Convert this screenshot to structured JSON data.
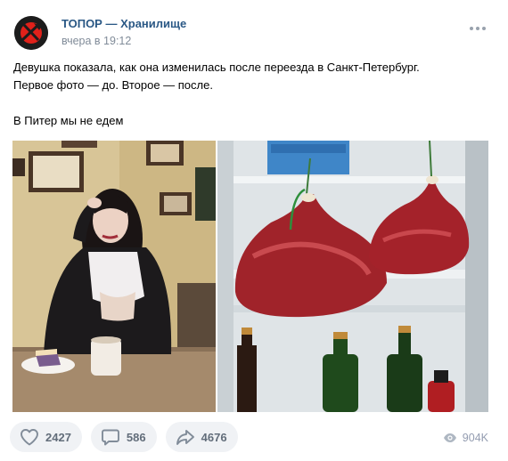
{
  "post": {
    "author": "ТОПОР — Хранилище",
    "time": "вчера в 19:12",
    "text_line1": "Девушка показала, как она изменилась после переезда в Санкт-Петербург.",
    "text_line2": "Первое фото — до. Второе — после.",
    "text_line3": "В Питер мы не едем"
  },
  "actions": {
    "likes": "2427",
    "comments": "586",
    "shares": "4676"
  },
  "views": "904K",
  "colors": {
    "link": "#2a5885",
    "muted": "#818c99",
    "accent_red": "#e0211a",
    "button_bg": "#f0f2f5"
  },
  "icons": {
    "avatar": "axe-logo",
    "more": "more-dots-icon",
    "like": "heart-icon",
    "comment": "comment-bubble-icon",
    "share": "share-arrow-icon",
    "views": "eye-icon"
  }
}
